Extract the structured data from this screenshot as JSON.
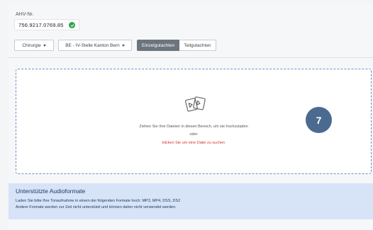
{
  "ahv": {
    "label": "AHV-Nr.",
    "value": "756.9217.0769.85",
    "status_color": "#2ea44f"
  },
  "filters": {
    "specialty": "Chirurgie",
    "office": "BE - IV-Stelle Kanton Bern",
    "report_types": [
      {
        "label": "Einzelgutachten",
        "active": true
      },
      {
        "label": "Teilgutachten",
        "active": false
      }
    ]
  },
  "dropzone": {
    "instruction": "Ziehen Sie Ihre Dateien in diesen Bereich, um sie hochzuladen",
    "or": "oder",
    "link": "klicken Sie um eine Datei zu suchen",
    "icon": "files-upload-icon"
  },
  "step_badge": "7",
  "info": {
    "title": "Unterstützte Audioformate",
    "line1": "Laden Sie bitte Ihre Tonaufnahme in einem der folgenden Formate hoch: MP3, MP4, DSS, DS2",
    "line2": "Andere Formate werden zur Zeit nicht unterstützt und können daher nicht verwendet werden."
  },
  "colors": {
    "accent": "#4b6a8f",
    "link": "#d9342b",
    "info_bg": "#d7e3f7"
  }
}
